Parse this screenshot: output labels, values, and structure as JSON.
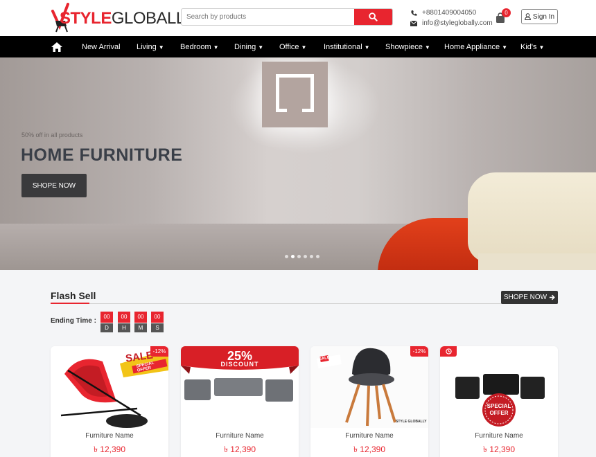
{
  "header": {
    "logo_red": "STYLE",
    "logo_dark": "GLOBALLY",
    "search_placeholder": "Search by products",
    "phone": "+8801409004050",
    "email": "info@styleglobally.com",
    "cart_count": "0",
    "signin_label": "Sign In"
  },
  "nav": {
    "items": [
      {
        "label": "New Arrival"
      },
      {
        "label": "Living"
      },
      {
        "label": "Bedroom"
      },
      {
        "label": "Dining"
      },
      {
        "label": "Office"
      },
      {
        "label": "Institutional"
      },
      {
        "label": "Showpiece"
      },
      {
        "label": "Home Appliance"
      },
      {
        "label": "Kid's"
      }
    ]
  },
  "hero": {
    "subtitle": "50% off in all products",
    "title": "HOME FURNITURE",
    "button_label": "SHOPE NOW",
    "slide_count": 6,
    "active_slide": 2
  },
  "flash": {
    "title": "Flash Sell",
    "shop_now_label": "SHOPE NOW",
    "ending_label": "Ending Time :",
    "countdown": [
      {
        "value": "00",
        "unit": "D"
      },
      {
        "value": "00",
        "unit": "H"
      },
      {
        "value": "00",
        "unit": "M"
      },
      {
        "value": "00",
        "unit": "S"
      }
    ]
  },
  "products": [
    {
      "name": "Furniture Name",
      "price": "৳ 12,390",
      "discount": "-12%",
      "banner": "SALE",
      "banner_sub": "SPECIAL OFFER"
    },
    {
      "name": "Furniture Name",
      "price": "৳ 12,390",
      "banner": "25%",
      "banner_sub": "DISCOUNT"
    },
    {
      "name": "Furniture Name",
      "price": "৳ 12,390",
      "discount": "-12%",
      "banner": "SALE",
      "watermark": "STYLE GLOBALLY"
    },
    {
      "name": "Furniture Name",
      "price": "৳ 12,390",
      "banner": "SPECIAL",
      "banner_sub": "OFFER"
    }
  ],
  "colors": {
    "accent": "#e8252f",
    "nav_bg": "#000000",
    "dark_button": "#333333"
  }
}
